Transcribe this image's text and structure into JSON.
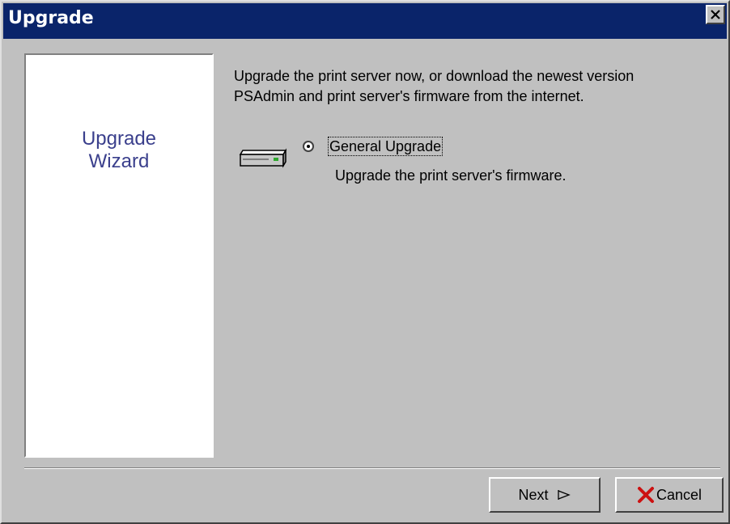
{
  "window": {
    "title": "Upgrade",
    "close_icon": "close-icon"
  },
  "wizard_panel": {
    "line1": "Upgrade",
    "line2": "Wizard"
  },
  "description": {
    "line1": "Upgrade the print server now, or download the newest version",
    "line2": "PSAdmin and print server's firmware from the internet."
  },
  "options": [
    {
      "label": "General Upgrade",
      "sublabel": "Upgrade the print server's firmware.",
      "selected": true,
      "icon": "print-server-device-icon"
    }
  ],
  "buttons": {
    "next_label": "Next",
    "next_icon": "arrow-right-icon",
    "cancel_label": "Cancel",
    "cancel_icon": "red-x-icon"
  },
  "colors": {
    "titlebar": "#0a246a",
    "wizard_text": "#3a3f8c",
    "face": "#c0c0c0",
    "cancel_icon": "#cc1111"
  }
}
